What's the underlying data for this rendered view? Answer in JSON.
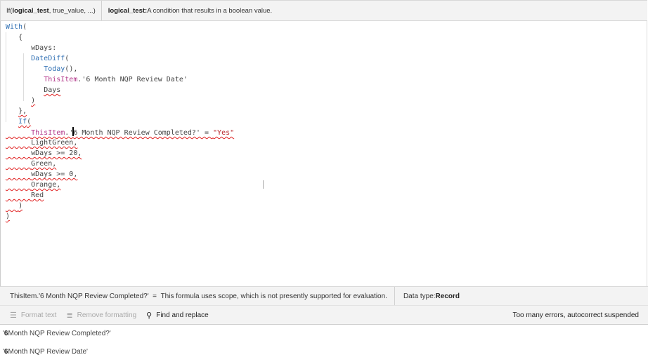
{
  "signature": {
    "fn": "If(",
    "param_bold": "logical_test",
    "rest": ", true_value, ...)"
  },
  "param_desc": {
    "name": "logical_test:",
    "text": " A condition that results in a boolean value."
  },
  "code_lines": [
    {
      "indent": 0,
      "sq": false,
      "tokens": [
        {
          "t": "With",
          "c": "kw"
        },
        {
          "t": "(",
          "c": ""
        }
      ]
    },
    {
      "indent": 1,
      "sq": false,
      "tokens": [
        {
          "t": "{",
          "c": ""
        }
      ]
    },
    {
      "indent": 2,
      "sq": false,
      "tokens": [
        {
          "t": "wDays:",
          "c": ""
        }
      ]
    },
    {
      "indent": 2,
      "sq": false,
      "tokens": [
        {
          "t": "DateDiff",
          "c": "kw"
        },
        {
          "t": "(",
          "c": ""
        }
      ]
    },
    {
      "indent": 3,
      "sq": false,
      "tokens": [
        {
          "t": "Today",
          "c": "kw"
        },
        {
          "t": "(),",
          "c": ""
        }
      ]
    },
    {
      "indent": 3,
      "sq": false,
      "tokens": [
        {
          "t": "ThisItem",
          "c": "ti"
        },
        {
          "t": ".'6 Month NQP Review Date'",
          "c": ""
        }
      ]
    },
    {
      "indent": 3,
      "sq": false,
      "tokens": [
        {
          "t": "Days",
          "c": "sq"
        }
      ]
    },
    {
      "indent": 2,
      "sq": false,
      "tokens": [
        {
          "t": ")",
          "c": "sq"
        }
      ]
    },
    {
      "indent": 1,
      "sq": false,
      "tokens": [
        {
          "t": "},",
          "c": "sq"
        }
      ]
    },
    {
      "indent": 1,
      "sq": false,
      "tokens": [
        {
          "t": "If",
          "c": "kw sq"
        },
        {
          "t": "(",
          "c": "sq"
        }
      ]
    },
    {
      "indent": 2,
      "sq": true,
      "caret": true,
      "tokens": [
        {
          "t": "ThisItem",
          "c": "ti"
        },
        {
          "t": ".'6",
          "c": ""
        },
        {
          "t": " Month NQP Review Completed?' = ",
          "c": ""
        },
        {
          "t": "\"Yes\"",
          "c": "str"
        }
      ]
    },
    {
      "indent": 2,
      "sq": true,
      "tokens": [
        {
          "t": "LightGreen,",
          "c": ""
        }
      ]
    },
    {
      "indent": 2,
      "sq": true,
      "tokens": [
        {
          "t": "wDays >= 20,",
          "c": ""
        }
      ]
    },
    {
      "indent": 2,
      "sq": true,
      "tokens": [
        {
          "t": "Green,",
          "c": ""
        }
      ]
    },
    {
      "indent": 2,
      "sq": true,
      "tokens": [
        {
          "t": "wDays >= 0,",
          "c": ""
        }
      ]
    },
    {
      "indent": 2,
      "sq": true,
      "tokens": [
        {
          "t": "Orange,",
          "c": ""
        }
      ]
    },
    {
      "indent": 2,
      "sq": true,
      "tokens": [
        {
          "t": "Red",
          "c": ""
        }
      ]
    },
    {
      "indent": 1,
      "sq": true,
      "tokens": [
        {
          "t": ")",
          "c": ""
        }
      ]
    },
    {
      "indent": 0,
      "sq": true,
      "tokens": [
        {
          "t": ")",
          "c": ""
        }
      ]
    }
  ],
  "result": {
    "expr": "ThisItem.'6 Month NQP Review Completed?'",
    "eq": "  =  ",
    "msg": "This formula uses scope, which is not presently supported for evaluation.",
    "type_label": "Data type: ",
    "type_value": "Record"
  },
  "toolbar": {
    "format_text": "Format text",
    "remove_formatting": "Remove formatting",
    "find_replace": "Find and replace",
    "status": "Too many errors, autocorrect suspended"
  },
  "suggestions": [
    {
      "prefix": "'",
      "bold": "6",
      "rest": " Month NQP Review Completed?'"
    },
    {
      "prefix": "'",
      "bold": "6",
      "rest": " Month NQP Review Date'"
    }
  ]
}
